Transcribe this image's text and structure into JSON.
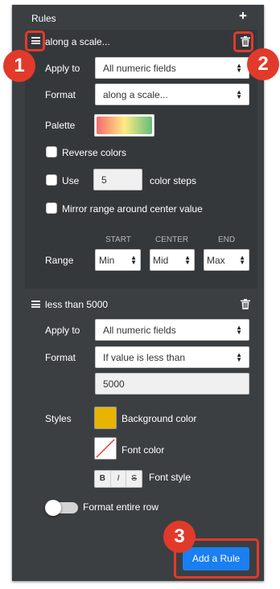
{
  "panel": {
    "title": "Rules",
    "add_icon": "+"
  },
  "rule1": {
    "name": "along a scale...",
    "apply_to_label": "Apply to",
    "apply_to_value": "All numeric fields",
    "format_label": "Format",
    "format_value": "along a scale...",
    "palette_label": "Palette",
    "reverse_colors_label": "Reverse colors",
    "use_label": "Use",
    "steps_value": "5",
    "color_steps_label": "color steps",
    "mirror_label": "Mirror range around center value",
    "range_label": "Range",
    "range_start_header": "START",
    "range_center_header": "CENTER",
    "range_end_header": "END",
    "range_start_value": "Min",
    "range_center_value": "Mid",
    "range_end_value": "Max"
  },
  "rule2": {
    "name": "less than 5000",
    "apply_to_label": "Apply to",
    "apply_to_value": "All numeric fields",
    "format_label": "Format",
    "format_value": "If value is less than",
    "threshold_value": "5000",
    "styles_label": "Styles",
    "background_color_label": "Background color",
    "background_color": "#e8b400",
    "font_color_label": "Font color",
    "font_style_label": "Font style",
    "font_style_bold": "B",
    "font_style_italic": "I",
    "font_style_strike": "S",
    "format_entire_row_label": "Format entire row"
  },
  "add_rule_label": "Add a Rule",
  "callouts": {
    "one": "1",
    "two": "2",
    "three": "3"
  },
  "colors": {
    "accent": "#1a7ff0",
    "callout": "#e23a2a",
    "panel": "#3c3f42"
  }
}
